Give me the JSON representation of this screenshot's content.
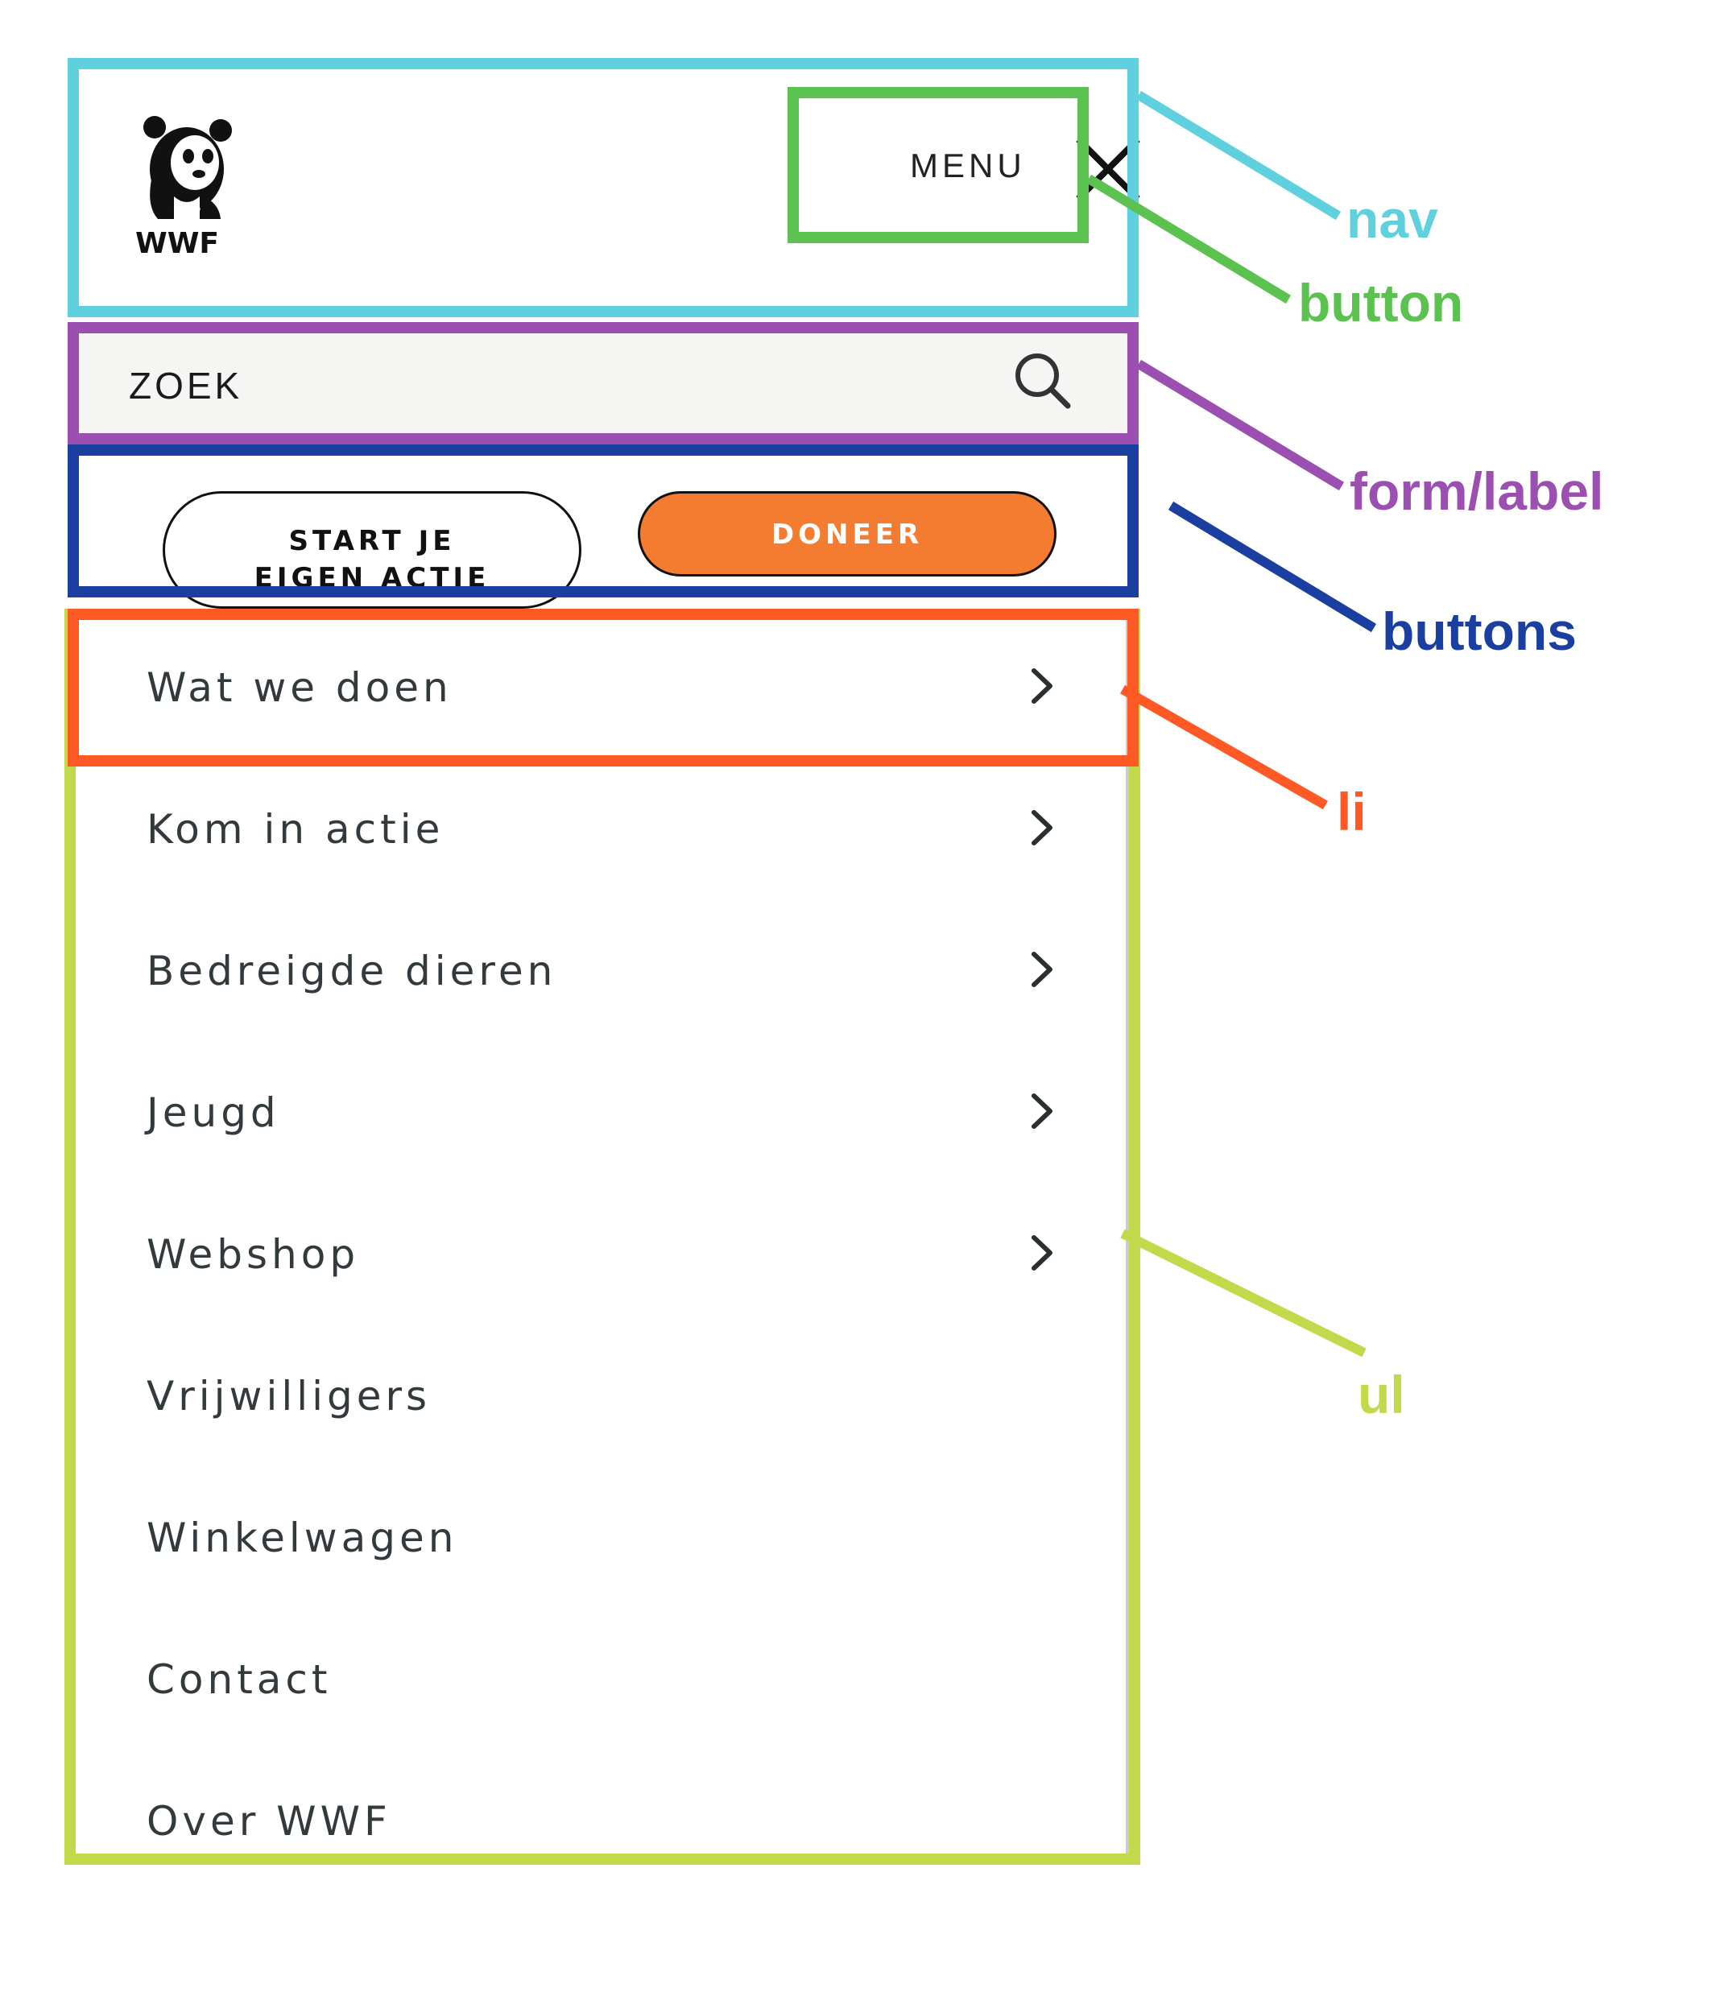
{
  "header": {
    "logo_text": "WWF",
    "menu_button_label": "MENU"
  },
  "search": {
    "label": "ZOEK"
  },
  "actions": {
    "start_label_line1": "START JE",
    "start_label_line2": "EIGEN ACTIE",
    "donate_label": "DONEER"
  },
  "menu": {
    "items": [
      {
        "label": "Wat we doen",
        "has_submenu": true
      },
      {
        "label": "Kom in actie",
        "has_submenu": true
      },
      {
        "label": "Bedreigde dieren",
        "has_submenu": true
      },
      {
        "label": "Jeugd",
        "has_submenu": true
      },
      {
        "label": "Webshop",
        "has_submenu": true
      },
      {
        "label": "Vrijwilligers",
        "has_submenu": false
      },
      {
        "label": "Winkelwagen",
        "has_submenu": false
      },
      {
        "label": "Contact",
        "has_submenu": false
      },
      {
        "label": "Over WWF",
        "has_submenu": false
      }
    ]
  },
  "annotations": [
    {
      "label": "nav",
      "color": "#5fd0de"
    },
    {
      "label": "button",
      "color": "#5cc24f"
    },
    {
      "label": "form/label",
      "color": "#9b4fb0"
    },
    {
      "label": "buttons",
      "color": "#1b3fa0"
    },
    {
      "label": "li",
      "color": "#ff5a26"
    },
    {
      "label": "ul",
      "color": "#c2d94c"
    }
  ],
  "colors": {
    "donate_orange": "#f47c30",
    "search_bg": "#f5f5f3",
    "menu_text": "#333a3d"
  }
}
